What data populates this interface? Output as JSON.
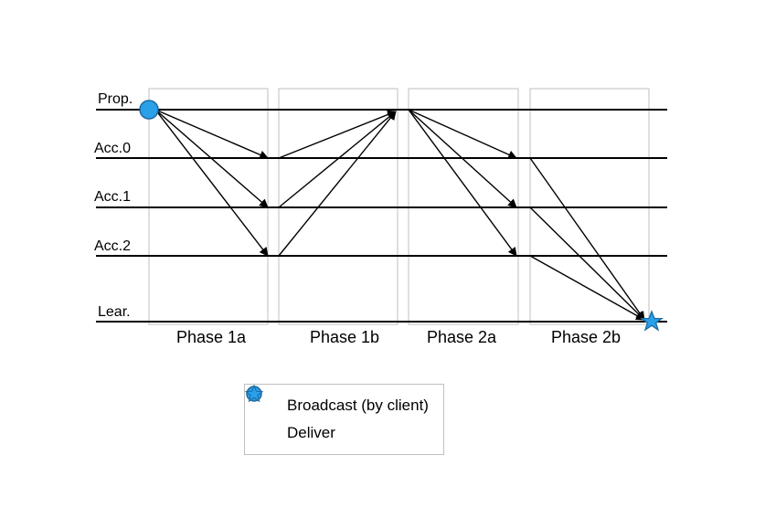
{
  "lanes": {
    "prop": "Prop.",
    "acc0": "Acc.0",
    "acc1": "Acc.1",
    "acc2": "Acc.2",
    "lear": "Lear."
  },
  "phases": {
    "p1a": "Phase 1a",
    "p1b": "Phase 1b",
    "p2a": "Phase 2a",
    "p2b": "Phase 2b"
  },
  "legend": {
    "broadcast": "Broadcast (by client)",
    "deliver": "Deliver"
  },
  "colors": {
    "marker_fill": "#2aa0e8",
    "marker_stroke": "#1c6aa0",
    "box_stroke": "#bfbfbf"
  },
  "chart_data": {
    "type": "timeline-message-diagram",
    "title": "",
    "lanes": [
      "Prop.",
      "Acc.0",
      "Acc.1",
      "Acc.2",
      "Lear."
    ],
    "phases": [
      "Phase 1a",
      "Phase 1b",
      "Phase 2a",
      "Phase 2b"
    ],
    "events": [
      {
        "lane": "Prop.",
        "time_phase": "start",
        "type": "broadcast"
      },
      {
        "lane": "Lear.",
        "time_phase": "Phase 2b end",
        "type": "deliver"
      }
    ],
    "messages": [
      {
        "phase": "Phase 1a",
        "from": "Prop.",
        "to": "Acc.0"
      },
      {
        "phase": "Phase 1a",
        "from": "Prop.",
        "to": "Acc.1"
      },
      {
        "phase": "Phase 1a",
        "from": "Prop.",
        "to": "Acc.2"
      },
      {
        "phase": "Phase 1b",
        "from": "Acc.0",
        "to": "Prop."
      },
      {
        "phase": "Phase 1b",
        "from": "Acc.1",
        "to": "Prop."
      },
      {
        "phase": "Phase 1b",
        "from": "Acc.2",
        "to": "Prop."
      },
      {
        "phase": "Phase 2a",
        "from": "Prop.",
        "to": "Acc.0"
      },
      {
        "phase": "Phase 2a",
        "from": "Prop.",
        "to": "Acc.1"
      },
      {
        "phase": "Phase 2a",
        "from": "Prop.",
        "to": "Acc.2"
      },
      {
        "phase": "Phase 2b",
        "from": "Acc.0",
        "to": "Lear."
      },
      {
        "phase": "Phase 2b",
        "from": "Acc.1",
        "to": "Lear."
      },
      {
        "phase": "Phase 2b",
        "from": "Acc.2",
        "to": "Lear."
      }
    ]
  }
}
